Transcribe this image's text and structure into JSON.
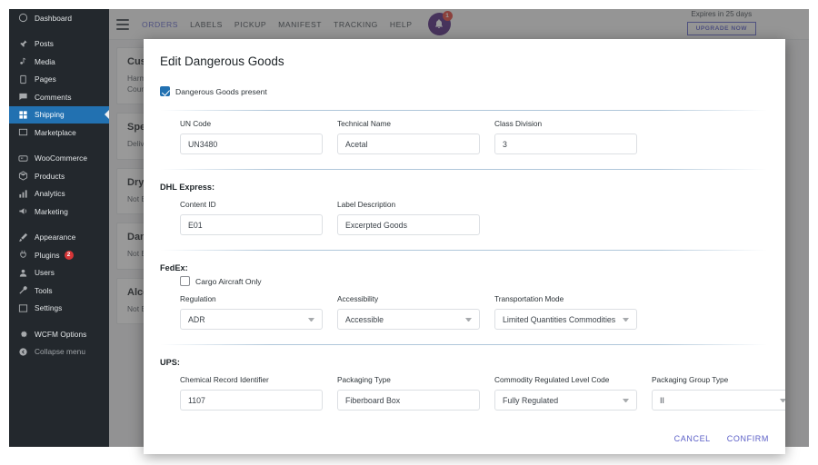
{
  "sidebar": {
    "items": [
      {
        "label": "Dashboard",
        "icon": "dashboard-icon",
        "group": 0
      },
      {
        "label": "Posts",
        "icon": "pin-icon",
        "group": 1
      },
      {
        "label": "Media",
        "icon": "media-icon",
        "group": 1
      },
      {
        "label": "Pages",
        "icon": "pages-icon",
        "group": 1
      },
      {
        "label": "Comments",
        "icon": "comment-icon",
        "group": 1
      },
      {
        "label": "Shipping",
        "icon": "grid-icon",
        "group": 1,
        "selected": true
      },
      {
        "label": "Marketplace",
        "icon": "marketplace-icon",
        "group": 1
      },
      {
        "label": "WooCommerce",
        "icon": "woocommerce-icon",
        "group": 2
      },
      {
        "label": "Products",
        "icon": "box-icon",
        "group": 2
      },
      {
        "label": "Analytics",
        "icon": "bar-chart-icon",
        "group": 2
      },
      {
        "label": "Marketing",
        "icon": "megaphone-icon",
        "group": 2
      },
      {
        "label": "Appearance",
        "icon": "brush-icon",
        "group": 3
      },
      {
        "label": "Plugins",
        "icon": "plug-icon",
        "group": 3,
        "badge": "2"
      },
      {
        "label": "Users",
        "icon": "user-icon",
        "group": 3
      },
      {
        "label": "Tools",
        "icon": "wrench-icon",
        "group": 3
      },
      {
        "label": "Settings",
        "icon": "sliders-icon",
        "group": 3
      },
      {
        "label": "WCFM Options",
        "icon": "gear-icon",
        "group": 4
      },
      {
        "label": "Collapse menu",
        "icon": "collapse-icon",
        "group": 4,
        "dim": true
      }
    ]
  },
  "topnav": {
    "menu_icon": "hamburger-icon",
    "links": [
      {
        "label": "ORDERS",
        "active": true
      },
      {
        "label": "LABELS",
        "active": false
      },
      {
        "label": "PICKUP",
        "active": false
      },
      {
        "label": "MANIFEST",
        "active": false
      },
      {
        "label": "TRACKING",
        "active": false
      },
      {
        "label": "HELP",
        "active": false
      }
    ],
    "bell_icon": "bell-icon",
    "bell_badge": "1",
    "expires_text": "Expires in 25 days",
    "upgrade_label": "UPGRADE NOW"
  },
  "background_cards": [
    {
      "title": "Customs",
      "lines": [
        "Harmonized code:",
        "Country of origin:"
      ]
    },
    {
      "title": "Special Services",
      "lines": [
        "Delivery confirmation:"
      ]
    },
    {
      "title": "Dry Ice",
      "lines": [
        "Not Enabled"
      ]
    },
    {
      "title": "Dangerous Goods",
      "lines": [
        "Not Enabled"
      ]
    },
    {
      "title": "Alcohol",
      "lines": [
        "Not Enabled"
      ]
    }
  ],
  "modal": {
    "title": "Edit Dangerous Goods",
    "present_checkbox": {
      "label": "Dangerous Goods present",
      "checked": true
    },
    "general_fields": [
      {
        "label": "UN Code",
        "value": "UN3480",
        "type": "text",
        "placeholder": "UN Code"
      },
      {
        "label": "Technical Name",
        "value": "Acetal",
        "type": "text",
        "placeholder": "Technical Name"
      },
      {
        "label": "Class Division",
        "value": "3",
        "type": "text",
        "placeholder": "Class Division"
      }
    ],
    "dhl": {
      "heading": "DHL Express:",
      "fields": [
        {
          "label": "Content ID",
          "value": "E01",
          "type": "text",
          "placeholder": "Content ID"
        },
        {
          "label": "Label Description",
          "value": "Excerpted Goods",
          "type": "text",
          "placeholder": "Label Description"
        }
      ]
    },
    "fedex": {
      "heading": "FedEx:",
      "cargo_checkbox": {
        "label": "Cargo Aircraft Only",
        "checked": false
      },
      "fields": [
        {
          "label": "Regulation",
          "value": "ADR",
          "type": "select"
        },
        {
          "label": "Accessibility",
          "value": "Accessible",
          "type": "select"
        },
        {
          "label": "Transportation Mode",
          "value": "Limited Quantities Commodities",
          "type": "select"
        }
      ]
    },
    "ups": {
      "heading": "UPS:",
      "fields": [
        {
          "label": "Chemical Record Identifier",
          "value": "1107",
          "type": "text",
          "placeholder": "Chemical Record Identifier"
        },
        {
          "label": "Packaging Type",
          "value": "Fiberboard Box",
          "type": "text",
          "placeholder": "Packaging Type"
        },
        {
          "label": "Commodity Regulated Level Code",
          "value": "Fully Regulated",
          "type": "select"
        },
        {
          "label": "Packaging Group Type",
          "value": "II",
          "type": "select"
        }
      ]
    },
    "cancel_label": "CANCEL",
    "confirm_label": "CONFIRM"
  },
  "colors": {
    "sidebar_bg": "#23282d",
    "accent_blue": "#2271b1",
    "link_purple": "#5b5fc7",
    "badge_red": "#d63638",
    "bell_purple": "#4b1e78"
  }
}
